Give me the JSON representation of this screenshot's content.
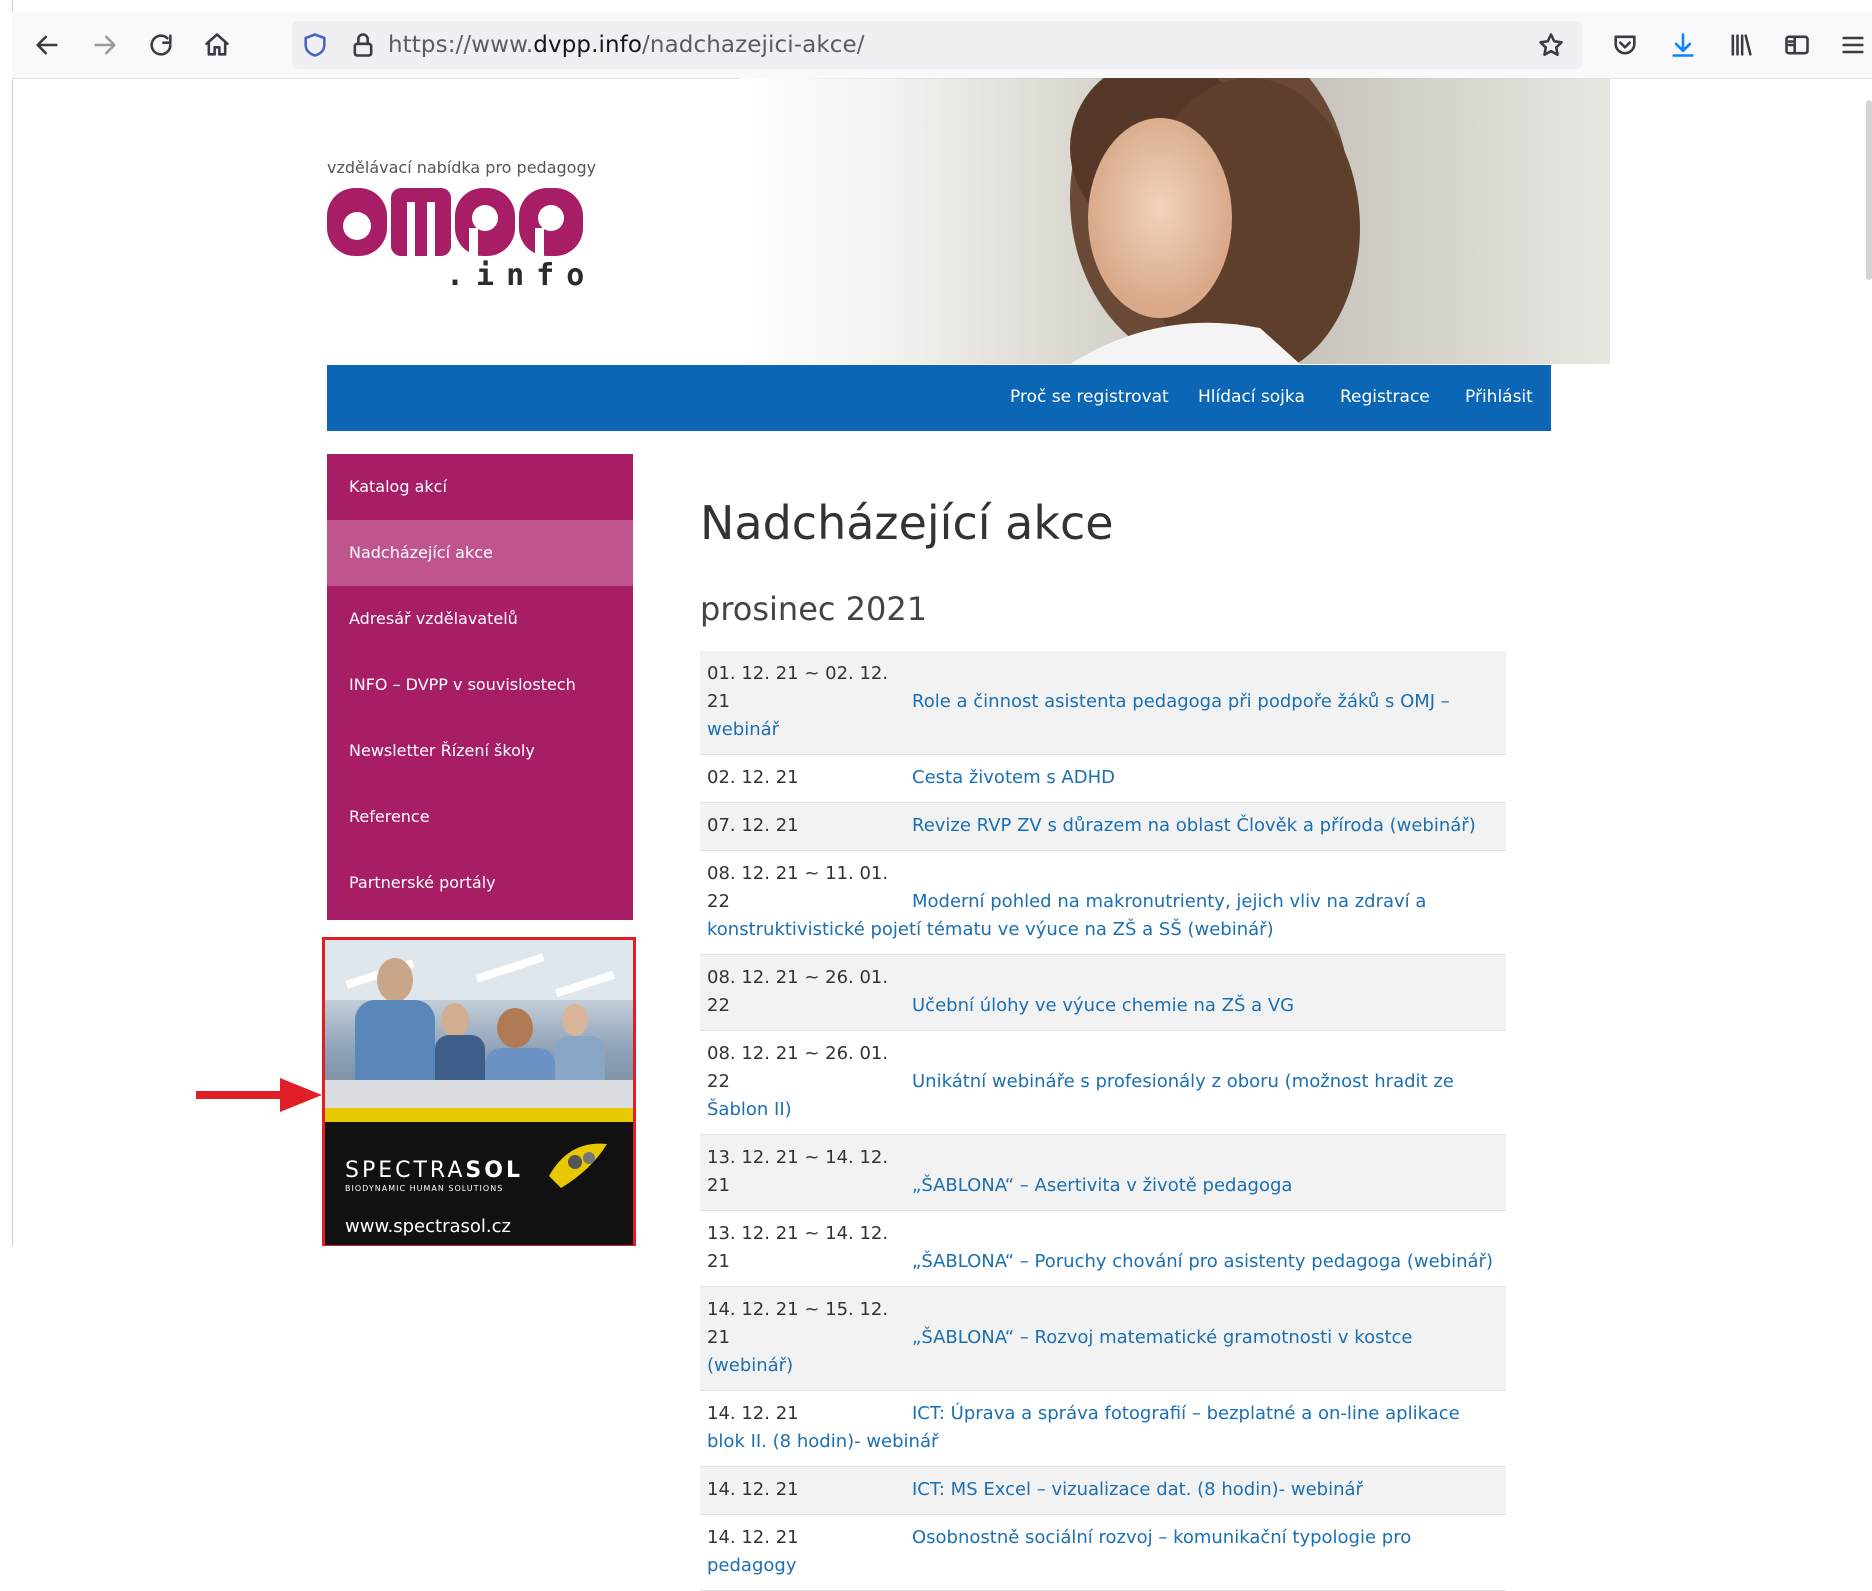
{
  "browser": {
    "url_prefix": "https://www.",
    "url_domain": "dvpp.info",
    "url_path": "/nadchazejici-akce/"
  },
  "header": {
    "tagline": "vzdělávací nabídka pro pedagogy",
    "logo_suffix": ".info"
  },
  "nav": {
    "items": [
      "Proč se registrovat",
      "Hlídací sojka",
      "Registrace",
      "Přihlásit"
    ]
  },
  "sidebar": {
    "items": [
      {
        "label": "Katalog akcí",
        "active": false
      },
      {
        "label": "Nadcházející akce",
        "active": true
      },
      {
        "label": "Adresář vzdělavatelů",
        "active": false
      },
      {
        "label": "INFO – DVPP v souvislostech",
        "active": false
      },
      {
        "label": "Newsletter Řízení školy",
        "active": false
      },
      {
        "label": "Reference",
        "active": false
      },
      {
        "label": "Partnerské portály",
        "active": false
      }
    ]
  },
  "ad": {
    "brand_light": "SPECTRA",
    "brand_bold": "SOL",
    "subtitle": "BIODYNAMIC HUMAN SOLUTIONS",
    "url": "www.spectrasol.cz"
  },
  "main": {
    "title": "Nadcházející akce",
    "month": "prosinec 2021",
    "events": [
      {
        "date": "01. 12. 21 ~ 02. 12. 21",
        "title": "Role a činnost asistenta pedagoga při podpoře žáků s OMJ – webinář"
      },
      {
        "date": "02. 12. 21",
        "title": "Cesta životem s ADHD"
      },
      {
        "date": "07. 12. 21",
        "title": "Revize RVP ZV s důrazem na oblast Člověk a příroda (webinář)"
      },
      {
        "date": "08. 12. 21 ~ 11. 01. 22",
        "title": "Moderní pohled na makronutrienty, jejich vliv na zdraví a konstruktivistické pojetí tématu ve výuce na ZŠ a SŠ (webinář)"
      },
      {
        "date": "08. 12. 21 ~ 26. 01. 22",
        "title": "Učební úlohy ve výuce chemie na ZŠ a VG"
      },
      {
        "date": "08. 12. 21 ~ 26. 01. 22",
        "title": "Unikátní webináře s profesionály z oboru (možnost hradit ze Šablon II)"
      },
      {
        "date": "13. 12. 21 ~ 14. 12. 21",
        "title": "„ŠABLONA“ – Asertivita v životě pedagoga"
      },
      {
        "date": "13. 12. 21 ~ 14. 12. 21",
        "title": "„ŠABLONA“ – Poruchy chování pro asistenty pedagoga (webinář)"
      },
      {
        "date": "14. 12. 21 ~ 15. 12. 21",
        "title": "„ŠABLONA“ – Rozvoj matematické gramotnosti v kostce (webinář)"
      },
      {
        "date": "14. 12. 21",
        "title": "ICT: Úprava a správa fotografií – bezplatné a on-line aplikace blok II. (8 hodin)- webinář"
      },
      {
        "date": "14. 12. 21",
        "title": "ICT: MS Excel – vizualizace dat. (8 hodin)- webinář"
      },
      {
        "date": "14. 12. 21",
        "title": "Osobnostně sociální rozvoj – komunikační typologie pro pedagogy"
      }
    ]
  },
  "colors": {
    "nav_blue": "#0b66b5",
    "sidebar_magenta": "#a71e66",
    "sidebar_active": "#c0558e",
    "link_blue": "#1b6fb3",
    "ad_border": "#e01e26"
  }
}
